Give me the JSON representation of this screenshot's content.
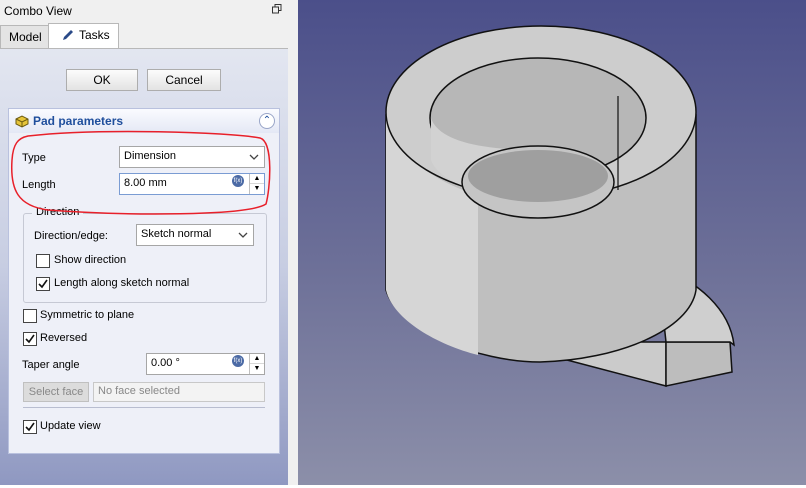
{
  "window": {
    "title": "Combo View"
  },
  "tabs": [
    {
      "label": "Model"
    },
    {
      "label": "Tasks"
    }
  ],
  "actions": {
    "ok": "OK",
    "cancel": "Cancel"
  },
  "pad": {
    "title": "Pad parameters",
    "type_label": "Type",
    "type_value": "Dimension",
    "length_label": "Length",
    "length_value": "8.00 mm",
    "direction": {
      "group_title": "Direction",
      "edge_label": "Direction/edge:",
      "edge_value": "Sketch normal",
      "show_direction": {
        "label": "Show direction",
        "checked": false
      },
      "along_normal": {
        "label": "Length along sketch normal",
        "checked": true
      }
    },
    "symmetric": {
      "label": "Symmetric to plane",
      "checked": false
    },
    "reversed": {
      "label": "Reversed",
      "checked": true
    },
    "taper_label": "Taper angle",
    "taper_value": "0.00 °",
    "select_face_label": "Select face",
    "face_placeholder": "No face selected",
    "update_view": {
      "label": "Update view",
      "checked": true
    }
  },
  "colors": {
    "highlight": "#e8202a",
    "title_blue": "#1f4e9c",
    "model_face": "#c9c9c9"
  }
}
